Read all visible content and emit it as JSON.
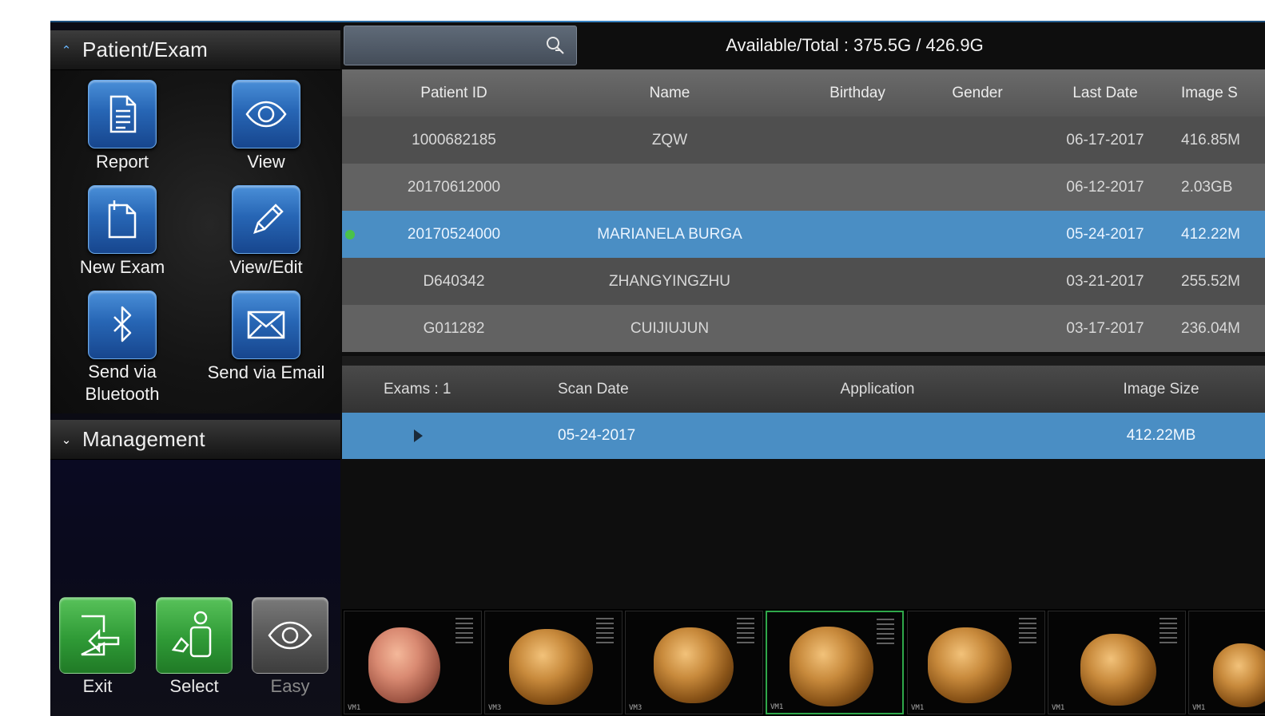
{
  "left": {
    "patient_section": {
      "title": "Patient/Exam"
    },
    "tools": [
      {
        "label": "Report",
        "icon": "report-icon"
      },
      {
        "label": "View",
        "icon": "eye-icon"
      },
      {
        "label": "New Exam",
        "icon": "new-exam-icon"
      },
      {
        "label": "View/Edit",
        "icon": "pencil-icon"
      },
      {
        "label": "Send via Bluetooth",
        "icon": "bluetooth-icon"
      },
      {
        "label": "Send via Email",
        "icon": "envelope-icon"
      }
    ],
    "management_section": {
      "title": "Management"
    },
    "bottom_buttons": [
      {
        "label": "Exit",
        "icon": "exit-icon"
      },
      {
        "label": "Select",
        "icon": "select-user-icon"
      },
      {
        "label": "Easy",
        "icon": "eye-icon"
      }
    ]
  },
  "search": {
    "placeholder": "",
    "icon": "search-icon"
  },
  "storage": {
    "text": "Available/Total : 375.5G / 426.9G"
  },
  "patients": {
    "headers": {
      "id": "Patient ID",
      "name": "Name",
      "birthday": "Birthday",
      "gender": "Gender",
      "last_date": "Last Date",
      "image_size": "Image S"
    },
    "rows": [
      {
        "id": "1000682185",
        "name": "ZQW",
        "birthday": "",
        "gender": "",
        "last_date": "06-17-2017",
        "image_size": "416.85M"
      },
      {
        "id": "20170612000",
        "name": "",
        "birthday": "",
        "gender": "",
        "last_date": "06-12-2017",
        "image_size": "2.03GB"
      },
      {
        "id": "20170524000",
        "name": "MARIANELA BURGA",
        "birthday": "",
        "gender": "",
        "last_date": "05-24-2017",
        "image_size": "412.22M",
        "selected": true
      },
      {
        "id": "D640342",
        "name": "ZHANGYINGZHU",
        "birthday": "",
        "gender": "",
        "last_date": "03-21-2017",
        "image_size": "255.52M"
      },
      {
        "id": "G011282",
        "name": "CUIJIUJUN",
        "birthday": "",
        "gender": "",
        "last_date": "03-17-2017",
        "image_size": "236.04M"
      }
    ]
  },
  "exams": {
    "headers": {
      "count": "Exams : 1",
      "scan_date": "Scan Date",
      "application": "Application",
      "image_size": "Image Size"
    },
    "rows": [
      {
        "scan_date": "05-24-2017",
        "application": "",
        "image_size": "412.22MB"
      }
    ]
  },
  "thumbnails": [
    {
      "label": "VM1"
    },
    {
      "label": "VM3"
    },
    {
      "label": "VM3"
    },
    {
      "label": "VM1"
    },
    {
      "label": "VM1"
    },
    {
      "label": "VM1"
    },
    {
      "label": "VM1"
    }
  ],
  "colors": {
    "accent_blue": "#4a8ec4",
    "button_blue": "#2766b5",
    "button_green": "#2f9a36",
    "selected_dot": "#4ac24a"
  }
}
